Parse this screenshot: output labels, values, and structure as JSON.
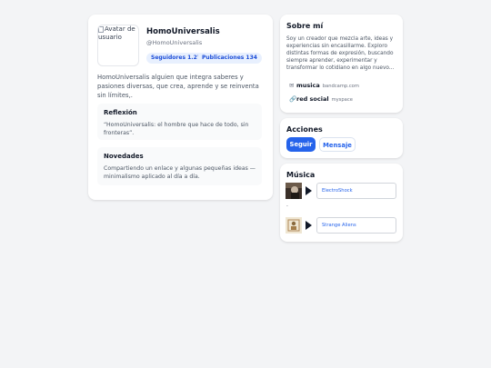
{
  "profile": {
    "avatar_alt": "Avatar de usuario",
    "name": "HomoUniversalis",
    "handle": "@HomoUniversalis",
    "followers_label": "Seguidores 1.2K",
    "posts_label": "Publicaciones 134",
    "bio": "HomoUniversalis alguien que integra saberes y pasiones diversas, que crea, aprende y se reinventa sin límites,.",
    "reflection": {
      "title": "Reflexión",
      "text": "“HomoUniversalis: el hombre que hace de todo, sin fronteras”."
    },
    "news": {
      "title": "Novedades",
      "text": "Compartiendo un enlace y algunas pequeñas ideas — minimalismo aplicado al día a día."
    }
  },
  "about": {
    "title": "Sobre mí",
    "text": "Soy un creador que mezcla arte, ideas y experiencias sin encasillarme. Exploro distintas formas de expresión, buscando siempre aprender, experimentar y transformar lo cotidiano en algo nuevo...",
    "links": [
      {
        "icon": "mail-icon",
        "glyph": "✉",
        "label": "musica",
        "host": "bandcamp.com"
      },
      {
        "icon": "link-icon",
        "glyph": "🔗",
        "label": "red social",
        "host": "myspace"
      }
    ]
  },
  "actions": {
    "title": "Acciones",
    "follow_label": "Seguir",
    "message_label": "Mensaje"
  },
  "music": {
    "title": "Música",
    "tracks": [
      {
        "name": "ElectroShock"
      },
      {
        "name": "Strange Aliens"
      }
    ],
    "separator": "."
  },
  "colors": {
    "accent": "#2563eb",
    "pill_bg": "#e8f0fe",
    "background": "#f3f4f6"
  }
}
